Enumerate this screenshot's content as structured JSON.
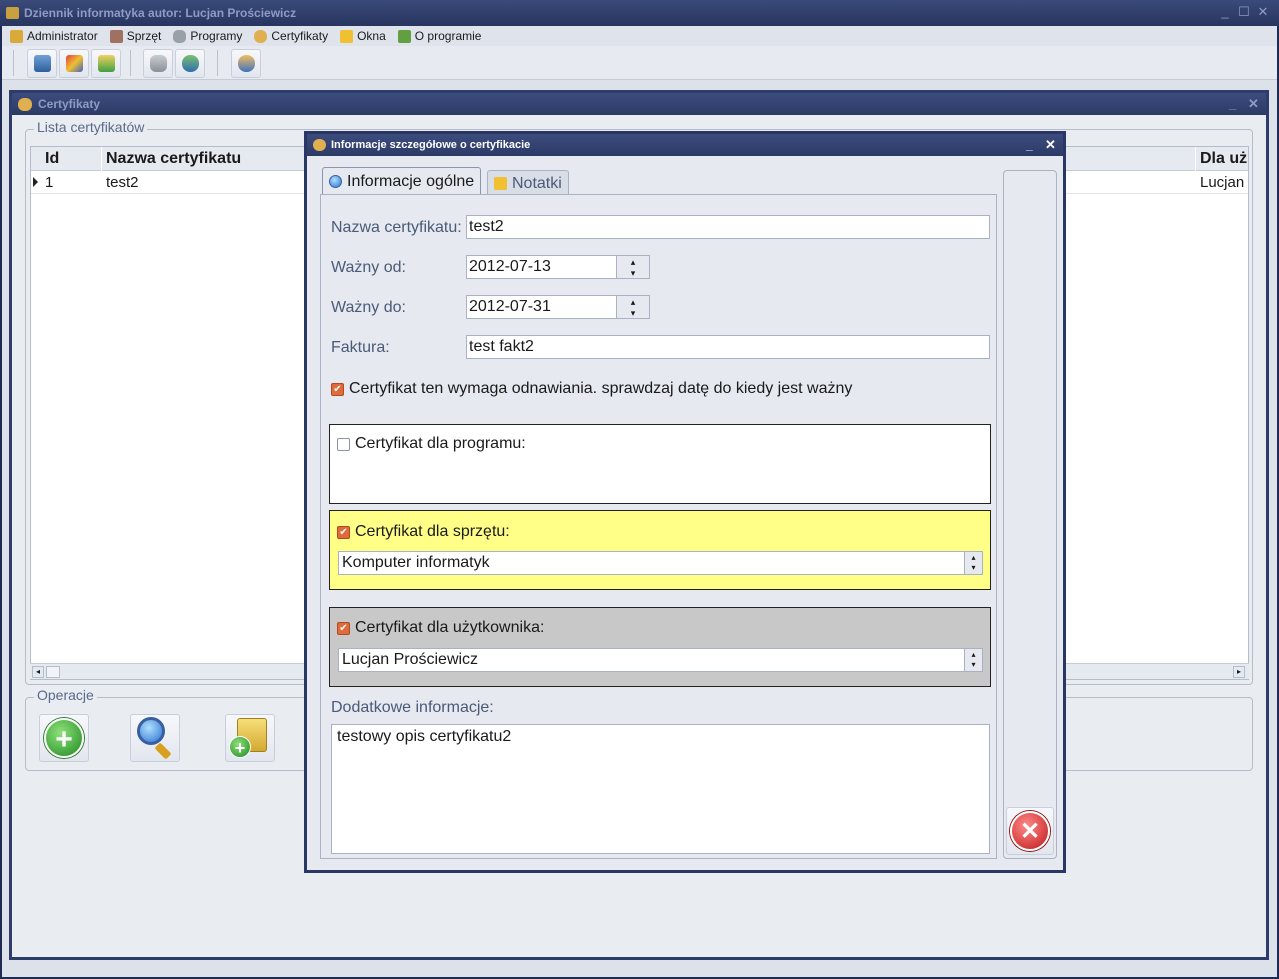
{
  "app": {
    "title": "Dziennik informatyka autor: Lucjan Prościewicz",
    "window_controls": [
      "_",
      "☐",
      "✕"
    ]
  },
  "menu": [
    {
      "label": "Administrator",
      "icon": "lock-icon"
    },
    {
      "label": "Sprzęt",
      "icon": "tools-icon"
    },
    {
      "label": "Programy",
      "icon": "database-icon"
    },
    {
      "label": "Certyfikaty",
      "icon": "users-icon"
    },
    {
      "label": "Okna",
      "icon": "windows-icon"
    },
    {
      "label": "O programie",
      "icon": "info-icon"
    }
  ],
  "toolbar": {
    "buttons": [
      "computer-icon",
      "cube-icon",
      "certificate-icon",
      "database-icon",
      "refresh-icon",
      "users-icon"
    ]
  },
  "certificates_window": {
    "title": "Certyfikaty",
    "list_group": "Lista certyfikatów",
    "columns": [
      "Id",
      "Nazwa certyfikatu",
      "Dla uż"
    ],
    "rows": [
      {
        "id": "1",
        "name": "test2",
        "user": "Lucjan"
      }
    ],
    "operations_group": "Operacje",
    "operation_buttons": [
      "add-icon",
      "search-icon",
      "add-certificate-icon"
    ]
  },
  "dialog": {
    "title": "Informacje szczegółowe o certyfikacie",
    "tabs": [
      {
        "label": "Informacje ogólne",
        "active": true
      },
      {
        "label": "Notatki",
        "active": false
      }
    ],
    "fields": {
      "name_label": "Nazwa certyfikatu:",
      "name_value": "test2",
      "valid_from_label": "Ważny od:",
      "valid_from_value": "2012-07-13",
      "valid_to_label": "Ważny do:",
      "valid_to_value": "2012-07-31",
      "invoice_label": "Faktura:",
      "invoice_value": "test fakt2",
      "renew_label": "Certyfikat ten wymaga odnawiania. sprawdzaj datę do kiedy jest ważny",
      "renew_checked": true
    },
    "program_panel": {
      "label": "Certyfikat dla programu:",
      "checked": false
    },
    "hardware_panel": {
      "label": "Certyfikat dla sprzętu:",
      "checked": true,
      "value": "Komputer informatyk",
      "color": "#ffff88"
    },
    "user_panel": {
      "label": "Certyfikat dla użytkownika:",
      "checked": true,
      "value": "Lucjan Prościewicz",
      "color": "#c8c8c8"
    },
    "extra_label": "Dodatkowe informacje:",
    "extra_value": "testowy opis certyfikatu2",
    "close_icon": "cancel-icon"
  }
}
